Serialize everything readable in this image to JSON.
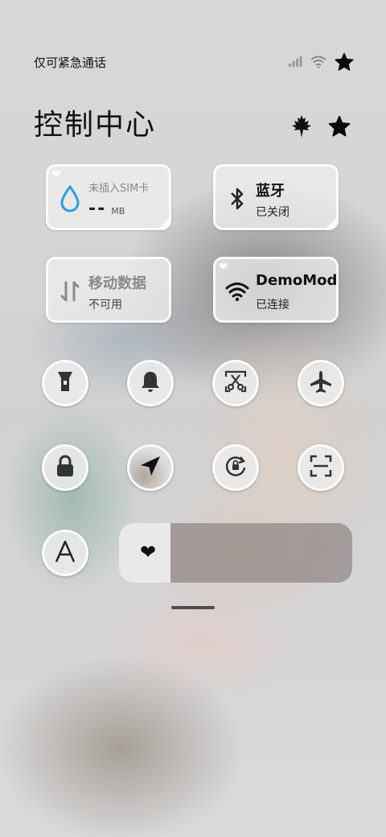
{
  "status_bar": {
    "carrier": "仅可紧急通话",
    "icons": [
      "signal-icon",
      "wifi-icon",
      "star-icon"
    ]
  },
  "title": "控制中心",
  "title_icons": [
    "maple-leaf-icon",
    "star-icon"
  ],
  "tiles": {
    "data_usage": {
      "label": "未插入SIM卡",
      "value": "--",
      "unit": "MB",
      "icon": "water-drop-icon"
    },
    "bluetooth": {
      "label": "蓝牙",
      "status": "已关闭",
      "icon": "bluetooth-icon"
    },
    "mobile_data": {
      "label": "移动数据",
      "status": "不可用",
      "icon": "mobile-data-arrows-icon"
    },
    "wifi": {
      "label": "DemoMod",
      "status": "已连接",
      "icon": "wifi-icon"
    }
  },
  "toggles": [
    {
      "name": "flashlight",
      "icon": "flashlight-icon"
    },
    {
      "name": "mute",
      "icon": "bell-icon"
    },
    {
      "name": "screenshot",
      "icon": "scissors-icon"
    },
    {
      "name": "airplane-mode",
      "icon": "airplane-icon"
    },
    {
      "name": "lock-screen",
      "icon": "lock-icon"
    },
    {
      "name": "location",
      "icon": "location-arrow-icon"
    },
    {
      "name": "rotation-lock",
      "icon": "rotation-lock-icon"
    },
    {
      "name": "scanner",
      "icon": "scan-icon"
    },
    {
      "name": "auto-font",
      "icon": "font-a-icon"
    }
  ],
  "brightness": {
    "icon": "heart-icon",
    "glyph": "❤",
    "level": 0.22
  },
  "colors": {
    "accent_blue": "#2f9be8",
    "text": "#111111",
    "tile_bg": "#f0f0f0"
  }
}
